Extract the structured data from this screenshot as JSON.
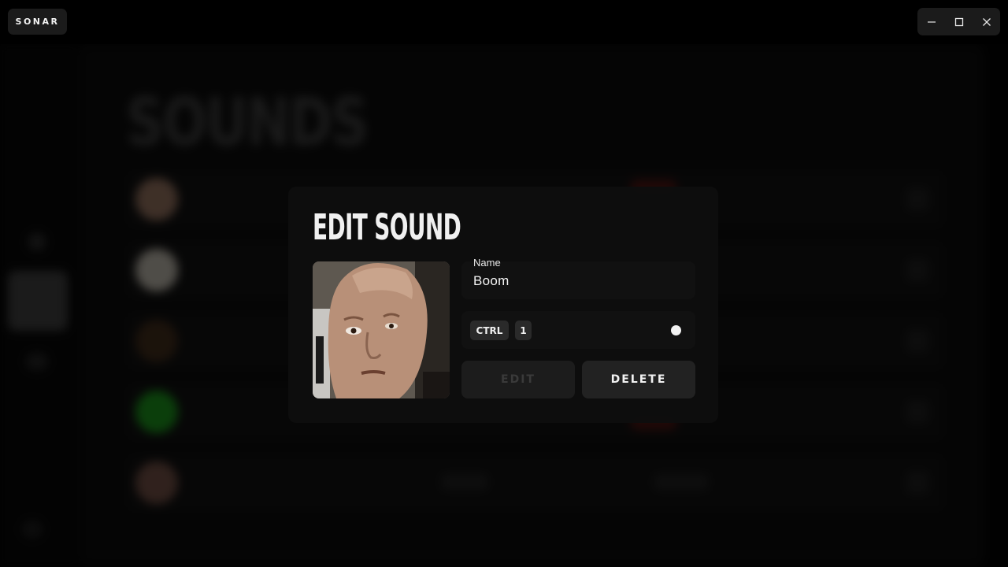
{
  "app": {
    "title": "SONAR"
  },
  "window_controls": [
    "minimize-icon",
    "maximize-icon",
    "close-icon"
  ],
  "modal": {
    "title": "EDIT SOUND",
    "name_label": "Name",
    "name_value": "Boom",
    "hotkeys": [
      "CTRL",
      "1"
    ],
    "edit_label": "EDIT",
    "delete_label": "DELETE"
  },
  "colors": {
    "background": "#000000",
    "modal": "#0e0e0e",
    "field": "#111111",
    "accent": "#f2f2f2"
  }
}
